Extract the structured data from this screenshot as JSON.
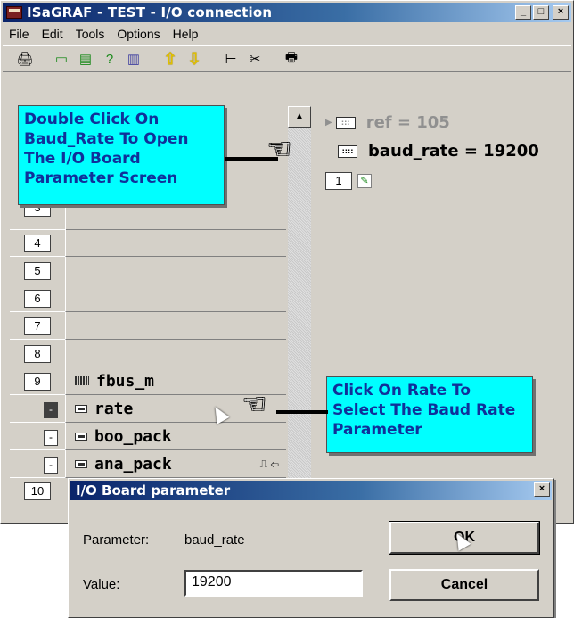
{
  "window": {
    "title": "ISaGRAF - TEST - I/O connection",
    "btn_min": "_",
    "btn_max": "□",
    "btn_close": "×"
  },
  "menu": [
    "File",
    "Edit",
    "Tools",
    "Options",
    "Help"
  ],
  "toolbar": {
    "icons": [
      "open-icon",
      "edit-icon",
      "connect-icon",
      "help-icon",
      "delete-icon",
      "up-arrow-icon",
      "down-arrow-icon",
      "tree-icon",
      "cut-icon",
      "print-icon"
    ]
  },
  "channels": [
    {
      "num": "3",
      "label": ""
    },
    {
      "num": "4",
      "label": ""
    },
    {
      "num": "5",
      "label": ""
    },
    {
      "num": "6",
      "label": ""
    },
    {
      "num": "7",
      "label": ""
    },
    {
      "num": "8",
      "label": ""
    },
    {
      "num": "9",
      "label": "fbus_m"
    }
  ],
  "subitems": [
    {
      "box": "-",
      "label": "rate"
    },
    {
      "box": "-",
      "label": "boo_pack"
    },
    {
      "box": "-",
      "label": "ana_pack",
      "suffix": "⎍ ⇦"
    }
  ],
  "channel10": "10",
  "right_panel": {
    "ref": "ref = 105",
    "baud": "baud_rate = 19200",
    "slot": "1"
  },
  "callouts": {
    "top": "Double Click On Baud_Rate To Open The I/O Board Parameter Screen",
    "bottom": "Click On Rate To Select The Baud Rate Parameter"
  },
  "dialog": {
    "title": "I/O Board parameter",
    "close": "×",
    "param_label": "Parameter:",
    "param_value": "baud_rate",
    "value_label": "Value:",
    "value": "19200",
    "ok": "OK",
    "cancel": "Cancel"
  }
}
